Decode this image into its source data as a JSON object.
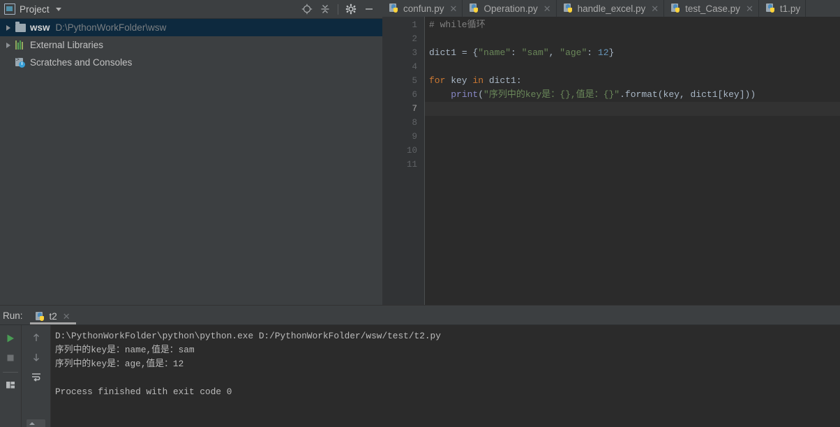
{
  "project_panel": {
    "title": "Project",
    "icons": {
      "project": "project-window-icon",
      "dropdown": "chevron-down-icon",
      "locate": "locate-target-icon",
      "collapse_all": "collapse-all-icon",
      "settings": "gear-icon",
      "hide": "minimize-icon"
    },
    "tree": [
      {
        "label": "wsw",
        "sub": "D:\\PythonWorkFolder\\wsw",
        "icon": "folder-icon",
        "has_arrow": true,
        "selected": true,
        "bold": true
      },
      {
        "label": "External Libraries",
        "sub": "",
        "icon": "libraries-icon",
        "has_arrow": true,
        "selected": false,
        "bold": false
      },
      {
        "label": "Scratches and Consoles",
        "sub": "",
        "icon": "scratches-icon",
        "has_arrow": false,
        "selected": false,
        "bold": false
      }
    ]
  },
  "editor": {
    "tabs": [
      {
        "label": "confun.py",
        "icon": "python-file-icon",
        "closable": true
      },
      {
        "label": "Operation.py",
        "icon": "python-file-icon",
        "closable": true
      },
      {
        "label": "handle_excel.py",
        "icon": "python-file-icon",
        "closable": true
      },
      {
        "label": "test_Case.py",
        "icon": "python-file-icon",
        "closable": true
      },
      {
        "label": "t1.py",
        "icon": "python-file-icon",
        "closable": false
      }
    ],
    "line_numbers": [
      "1",
      "2",
      "3",
      "4",
      "5",
      "6",
      "7",
      "8",
      "9",
      "10",
      "11"
    ],
    "active_line": 7,
    "code_lines": [
      {
        "n": 1,
        "tokens": [
          {
            "t": "# while循环",
            "c": "comment"
          }
        ]
      },
      {
        "n": 2,
        "tokens": []
      },
      {
        "n": 3,
        "tokens": [
          {
            "t": "dict1 ",
            "c": "plain"
          },
          {
            "t": "= ",
            "c": "plain"
          },
          {
            "t": "{",
            "c": "plain"
          },
          {
            "t": "\"name\"",
            "c": "str"
          },
          {
            "t": ": ",
            "c": "plain"
          },
          {
            "t": "\"sam\"",
            "c": "str"
          },
          {
            "t": ", ",
            "c": "plain"
          },
          {
            "t": "\"age\"",
            "c": "str"
          },
          {
            "t": ": ",
            "c": "plain"
          },
          {
            "t": "12",
            "c": "num"
          },
          {
            "t": "}",
            "c": "plain"
          }
        ]
      },
      {
        "n": 4,
        "tokens": []
      },
      {
        "n": 5,
        "tokens": [
          {
            "t": "for",
            "c": "kw"
          },
          {
            "t": " key ",
            "c": "plain"
          },
          {
            "t": "in",
            "c": "kw"
          },
          {
            "t": " dict1:",
            "c": "plain"
          }
        ]
      },
      {
        "n": 6,
        "tokens": [
          {
            "t": "    ",
            "c": "plain"
          },
          {
            "t": "print",
            "c": "fn"
          },
          {
            "t": "(",
            "c": "plain"
          },
          {
            "t": "\"序列中的key是：",
            "c": "str"
          },
          {
            "t": "{}",
            "c": "str"
          },
          {
            "t": ",值是：",
            "c": "str"
          },
          {
            "t": "{}",
            "c": "str"
          },
          {
            "t": "\"",
            "c": "str"
          },
          {
            "t": ".format(key, dict1[key]))",
            "c": "plain"
          }
        ]
      },
      {
        "n": 7,
        "tokens": []
      },
      {
        "n": 8,
        "tokens": []
      },
      {
        "n": 9,
        "tokens": []
      },
      {
        "n": 10,
        "tokens": []
      },
      {
        "n": 11,
        "tokens": []
      }
    ]
  },
  "run_panel": {
    "label": "Run:",
    "tab_label": "t2",
    "tab_icon": "python-file-icon",
    "tab_close": "close-icon",
    "toolbar": {
      "rerun": "run-play-icon",
      "stop": "stop-icon",
      "layout": "layout-icon",
      "up": "arrow-up-icon",
      "down": "arrow-down-icon",
      "soft_wrap": "soft-wrap-icon"
    },
    "console_lines": [
      "D:\\PythonWorkFolder\\python\\python.exe D:/PythonWorkFolder/wsw/test/t2.py",
      "序列中的key是：name,值是：sam",
      "序列中的key是：age,值是：12",
      "",
      "Process finished with exit code 0"
    ]
  },
  "colors": {
    "chrome": "#3c3f41",
    "editor_bg": "#2b2b2b",
    "gutter_bg": "#313335",
    "active_line": "#323232",
    "selection_blue": "#0d293e",
    "keyword": "#cc7832",
    "string": "#6a8759",
    "number": "#6897bb",
    "function": "#8888c6",
    "comment": "#808080",
    "text": "#a9b7c6",
    "run_green": "#499c54"
  }
}
